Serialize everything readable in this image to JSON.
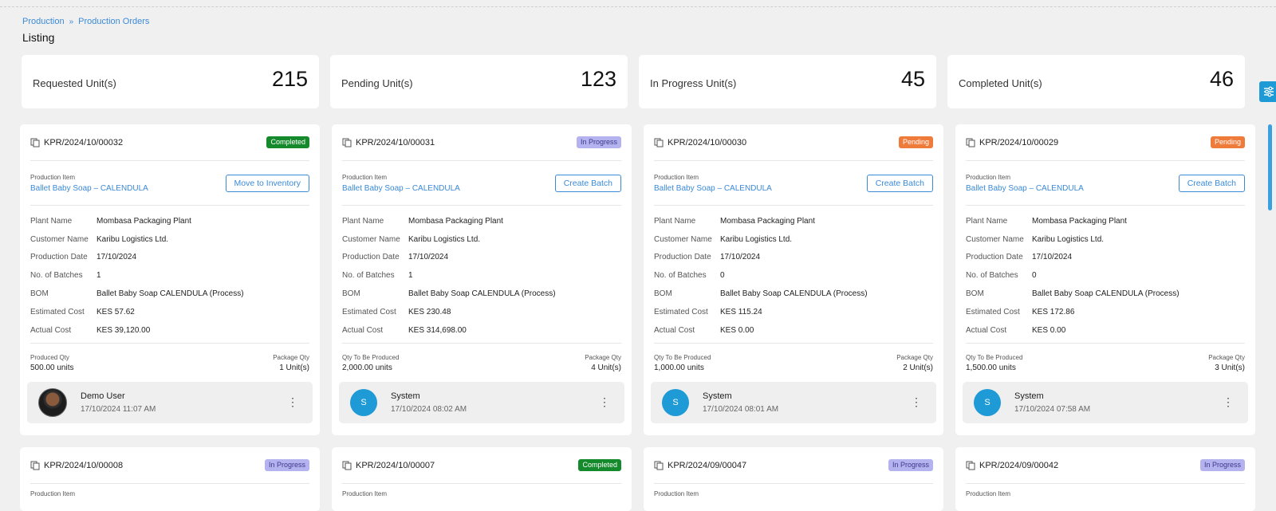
{
  "breadcrumb": {
    "root": "Production",
    "current": "Production Orders"
  },
  "page_title": "Listing",
  "stats": [
    {
      "label": "Requested Unit(s)",
      "value": "215"
    },
    {
      "label": "Pending Unit(s)",
      "value": "123"
    },
    {
      "label": "In Progress Unit(s)",
      "value": "45"
    },
    {
      "label": "Completed Unit(s)",
      "value": "46"
    }
  ],
  "labels": {
    "production_item": "Production Item",
    "plant": "Plant Name",
    "customer": "Customer Name",
    "date": "Production Date",
    "batches": "No. of Batches",
    "bom": "BOM",
    "est": "Estimated Cost",
    "act": "Actual Cost",
    "pkg": "Package Qty"
  },
  "colors": {
    "accent": "#3b8ad8",
    "completed": "#158a2c",
    "in_progress": "#b5b2f0",
    "pending": "#ef7b3a"
  },
  "cards": [
    {
      "id": "KPR/2024/10/00032",
      "status": "Completed",
      "item": "Ballet Baby Soap – CALENDULA",
      "action": "Move to Inventory",
      "plant": "Mombasa Packaging Plant",
      "customer": "Karibu Logistics Ltd.",
      "date": "17/10/2024",
      "batches": "1",
      "bom": "Ballet Baby Soap CALENDULA (Process)",
      "est": "KES 57.62",
      "act": "KES 39,120.00",
      "qty_label": "Produced Qty",
      "qty": "500.00 units",
      "pkg": "1 Unit(s)",
      "user": "Demo User",
      "time": "17/10/2024 11:07 AM"
    },
    {
      "id": "KPR/2024/10/00031",
      "status": "In Progress",
      "item": "Ballet Baby Soap – CALENDULA",
      "action": "Create Batch",
      "plant": "Mombasa Packaging Plant",
      "customer": "Karibu Logistics Ltd.",
      "date": "17/10/2024",
      "batches": "1",
      "bom": "Ballet Baby Soap CALENDULA (Process)",
      "est": "KES 230.48",
      "act": "KES 314,698.00",
      "qty_label": "Qty To Be Produced",
      "qty": "2,000.00 units",
      "pkg": "4 Unit(s)",
      "initial": "S",
      "user": "System",
      "time": "17/10/2024 08:02 AM"
    },
    {
      "id": "KPR/2024/10/00030",
      "status": "Pending",
      "item": "Ballet Baby Soap – CALENDULA",
      "action": "Create Batch",
      "plant": "Mombasa Packaging Plant",
      "customer": "Karibu Logistics Ltd.",
      "date": "17/10/2024",
      "batches": "0",
      "bom": "Ballet Baby Soap CALENDULA (Process)",
      "est": "KES 115.24",
      "act": "KES 0.00",
      "qty_label": "Qty To Be Produced",
      "qty": "1,000.00 units",
      "pkg": "2 Unit(s)",
      "initial": "S",
      "user": "System",
      "time": "17/10/2024 08:01 AM"
    },
    {
      "id": "KPR/2024/10/00029",
      "status": "Pending",
      "item": "Ballet Baby Soap – CALENDULA",
      "action": "Create Batch",
      "plant": "Mombasa Packaging Plant",
      "customer": "Karibu Logistics Ltd.",
      "date": "17/10/2024",
      "batches": "0",
      "bom": "Ballet Baby Soap CALENDULA (Process)",
      "est": "KES 172.86",
      "act": "KES 0.00",
      "qty_label": "Qty To Be Produced",
      "qty": "1,500.00 units",
      "pkg": "3 Unit(s)",
      "initial": "S",
      "user": "System",
      "time": "17/10/2024 07:58 AM"
    }
  ],
  "cards_row2": [
    {
      "id": "KPR/2024/10/00008",
      "status": "In Progress"
    },
    {
      "id": "KPR/2024/10/00007",
      "status": "Completed"
    },
    {
      "id": "KPR/2024/09/00047",
      "status": "In Progress"
    },
    {
      "id": "KPR/2024/09/00042",
      "status": "In Progress"
    }
  ]
}
